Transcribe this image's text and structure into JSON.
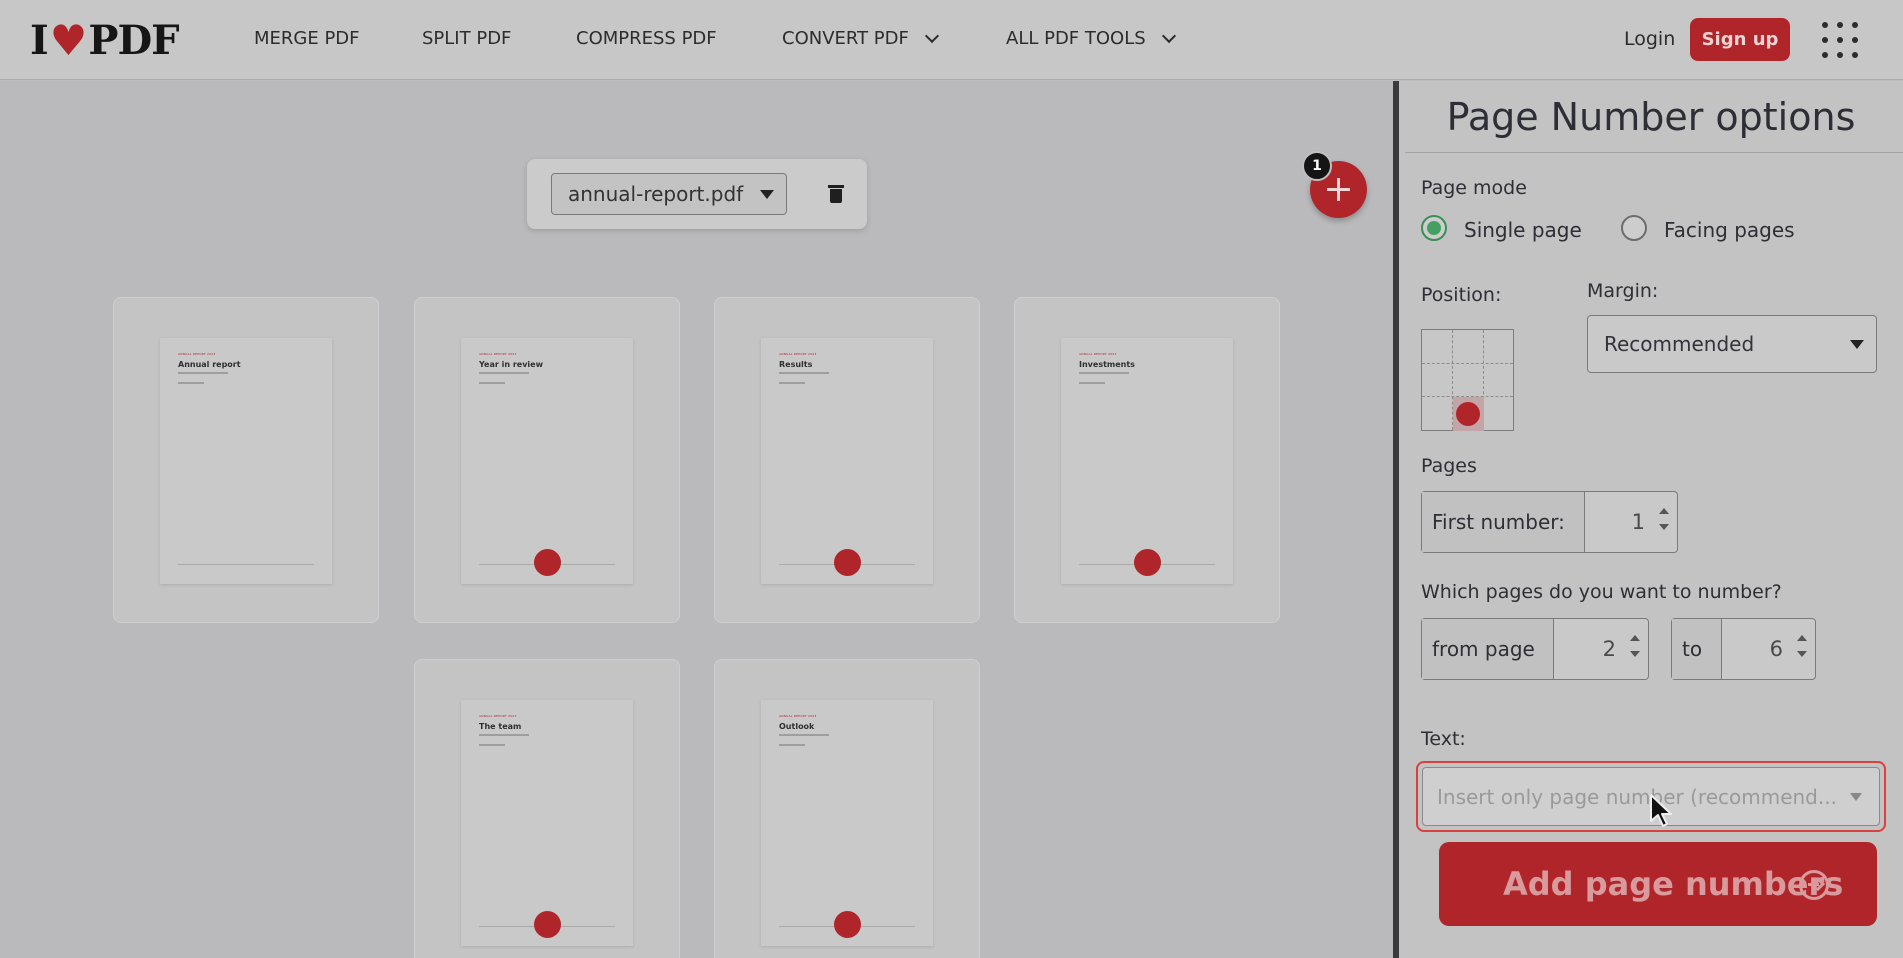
{
  "header": {
    "logo": {
      "left": "I",
      "right": "PDF"
    },
    "nav": [
      {
        "label": "MERGE PDF"
      },
      {
        "label": "SPLIT PDF"
      },
      {
        "label": "COMPRESS PDF"
      },
      {
        "label": "CONVERT PDF"
      },
      {
        "label": "ALL PDF TOOLS"
      }
    ],
    "login": "Login",
    "signup": "Sign up"
  },
  "workspace": {
    "file_name": "annual-report.pdf",
    "file_count": "1",
    "pages": [
      {
        "tag": "ANNUAL REPORT 2023",
        "title": "Annual report"
      },
      {
        "tag": "ANNUAL REPORT 2023",
        "title": "Year in review"
      },
      {
        "tag": "ANNUAL REPORT 2023",
        "title": "Results"
      },
      {
        "tag": "ANNUAL REPORT 2023",
        "title": "Investments"
      },
      {
        "tag": "ANNUAL REPORT 2023",
        "title": "The team"
      },
      {
        "tag": "ANNUAL REPORT 2023",
        "title": "Outlook"
      }
    ]
  },
  "sidebar": {
    "title": "Page Number options",
    "page_mode": {
      "label": "Page mode",
      "options": [
        {
          "label": "Single page",
          "selected": true
        },
        {
          "label": "Facing pages",
          "selected": false
        }
      ]
    },
    "position": {
      "label": "Position:",
      "selected": "bottom-center"
    },
    "margin": {
      "label": "Margin:",
      "value": "Recommended"
    },
    "pages": {
      "label": "Pages",
      "first_number_label": "First number:",
      "first_number": "1"
    },
    "range": {
      "label": "Which pages do you want to number?",
      "from_label": "from page",
      "from_value": "2",
      "to_label": "to",
      "to_value": "6"
    },
    "text": {
      "label": "Text:",
      "placeholder": "Insert only page number (recommend..."
    },
    "submit": "Add page numbers"
  },
  "colors": {
    "brand": "#b0252a",
    "radio_selected": "#43a061",
    "focus_border": "#d8413f"
  }
}
